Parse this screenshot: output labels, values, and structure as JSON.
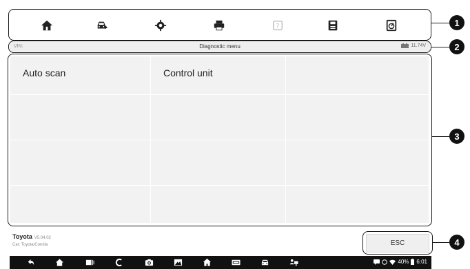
{
  "toolbar": {
    "icons": [
      "home-icon",
      "vehicle-swap-icon",
      "settings-icon",
      "print-icon",
      "help-icon",
      "save-icon",
      "data-logging-icon"
    ]
  },
  "statusbar": {
    "vin_label": "VIN:",
    "title": "Diagnostic menu",
    "battery_voltage": "11.74V"
  },
  "menu": {
    "items": [
      {
        "label": "Auto scan"
      },
      {
        "label": "Control unit"
      }
    ]
  },
  "vehicle": {
    "make": "Toyota",
    "version": "V5.04.02",
    "model": "Car: Toyota/Corolla"
  },
  "buttons": {
    "esc_label": "ESC"
  },
  "callouts": [
    "1",
    "2",
    "3",
    "4"
  ],
  "system": {
    "battery_percent": "40%",
    "time": "6:01"
  },
  "colors": {
    "frame": "#1a1a1a",
    "grid_bg": "#f2f2f2",
    "navbar_bg": "#111111",
    "help_disabled": "#bbbbbb"
  }
}
